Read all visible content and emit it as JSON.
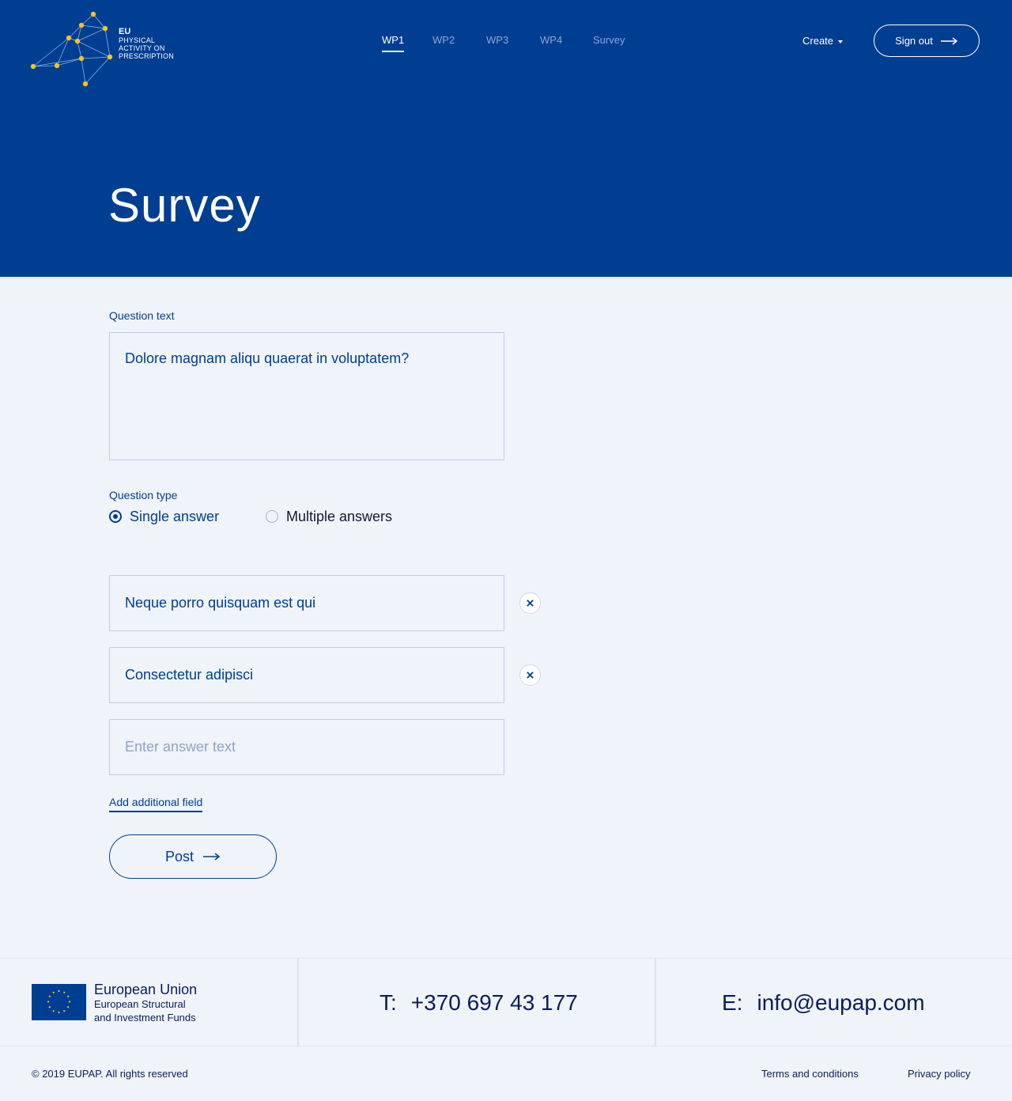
{
  "brand": {
    "logo_lines": [
      "EU",
      "PHYSICAL",
      "ACTIVITY ON",
      "PRESCRIPTION"
    ],
    "accent_color": "#003e92",
    "node_color": "#f5c518"
  },
  "nav": {
    "items": [
      {
        "label": "WP1",
        "active": true
      },
      {
        "label": "WP2",
        "active": false
      },
      {
        "label": "WP3",
        "active": false
      },
      {
        "label": "WP4",
        "active": false
      },
      {
        "label": "Survey",
        "active": false
      }
    ],
    "create_label": "Create",
    "signout_label": "Sign out"
  },
  "page": {
    "title": "Survey"
  },
  "form": {
    "question_text_label": "Question text",
    "question_text_value": "Dolore magnam aliqu quaerat in voluptatem?",
    "question_type_label": "Question type",
    "options": [
      {
        "label": "Single answer",
        "selected": true
      },
      {
        "label": "Multiple answers",
        "selected": false
      }
    ],
    "answers": [
      {
        "value": "Neque porro quisquam est qui"
      },
      {
        "value": "Consectetur adipisci"
      }
    ],
    "new_answer_placeholder": "Enter answer text",
    "add_field_label": "Add additional field",
    "post_label": "Post"
  },
  "footer": {
    "eu_name": "European Union",
    "eu_sub_line1": "European Structural",
    "eu_sub_line2": "and Investment Funds",
    "phone_prefix": "T:",
    "phone": "+370 697 43 177",
    "email_prefix": "E:",
    "email": "info@eupap.com",
    "copyright": "© 2019 EUPAP. All rights reserved",
    "terms_label": "Terms and conditions",
    "privacy_label": "Privacy policy"
  }
}
